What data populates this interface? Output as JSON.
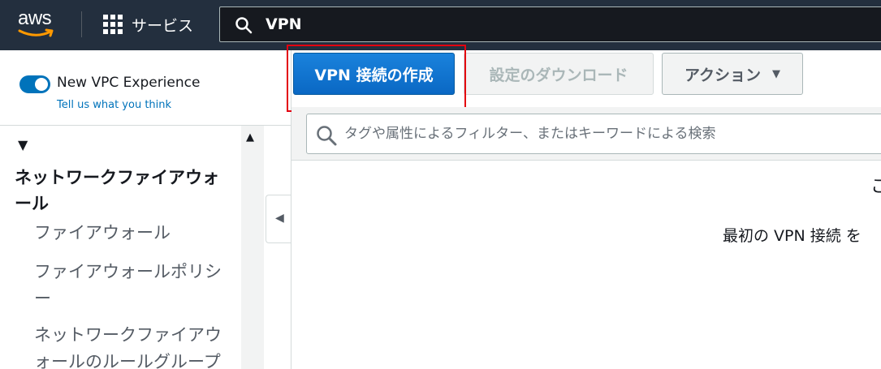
{
  "nav": {
    "logo_text": "aws",
    "services_label": "サービス",
    "search_value": "VPN"
  },
  "sidebar": {
    "experience_label": "New VPC Experience",
    "experience_enabled": true,
    "feedback_link": "Tell us what you think",
    "section_title": "ネットワークファイアウォール",
    "items": [
      {
        "label": "ファイアウォール"
      },
      {
        "label": "ファイアウォールポリシー"
      },
      {
        "label": "ネットワークファイアウォールのルールグループ"
      }
    ]
  },
  "toolbar": {
    "create_label": "VPN 接続の作成",
    "download_label": "設定のダウンロード",
    "actions_label": "アクション"
  },
  "filter": {
    "placeholder": "タグや属性によるフィルター、またはキーワードによる検索"
  },
  "main": {
    "empty_partial": "こ",
    "empty_message": "最初の VPN 接続 を"
  },
  "colors": {
    "nav_bg": "#232f3e",
    "primary": "#0073bb",
    "highlight": "#e3000f"
  }
}
